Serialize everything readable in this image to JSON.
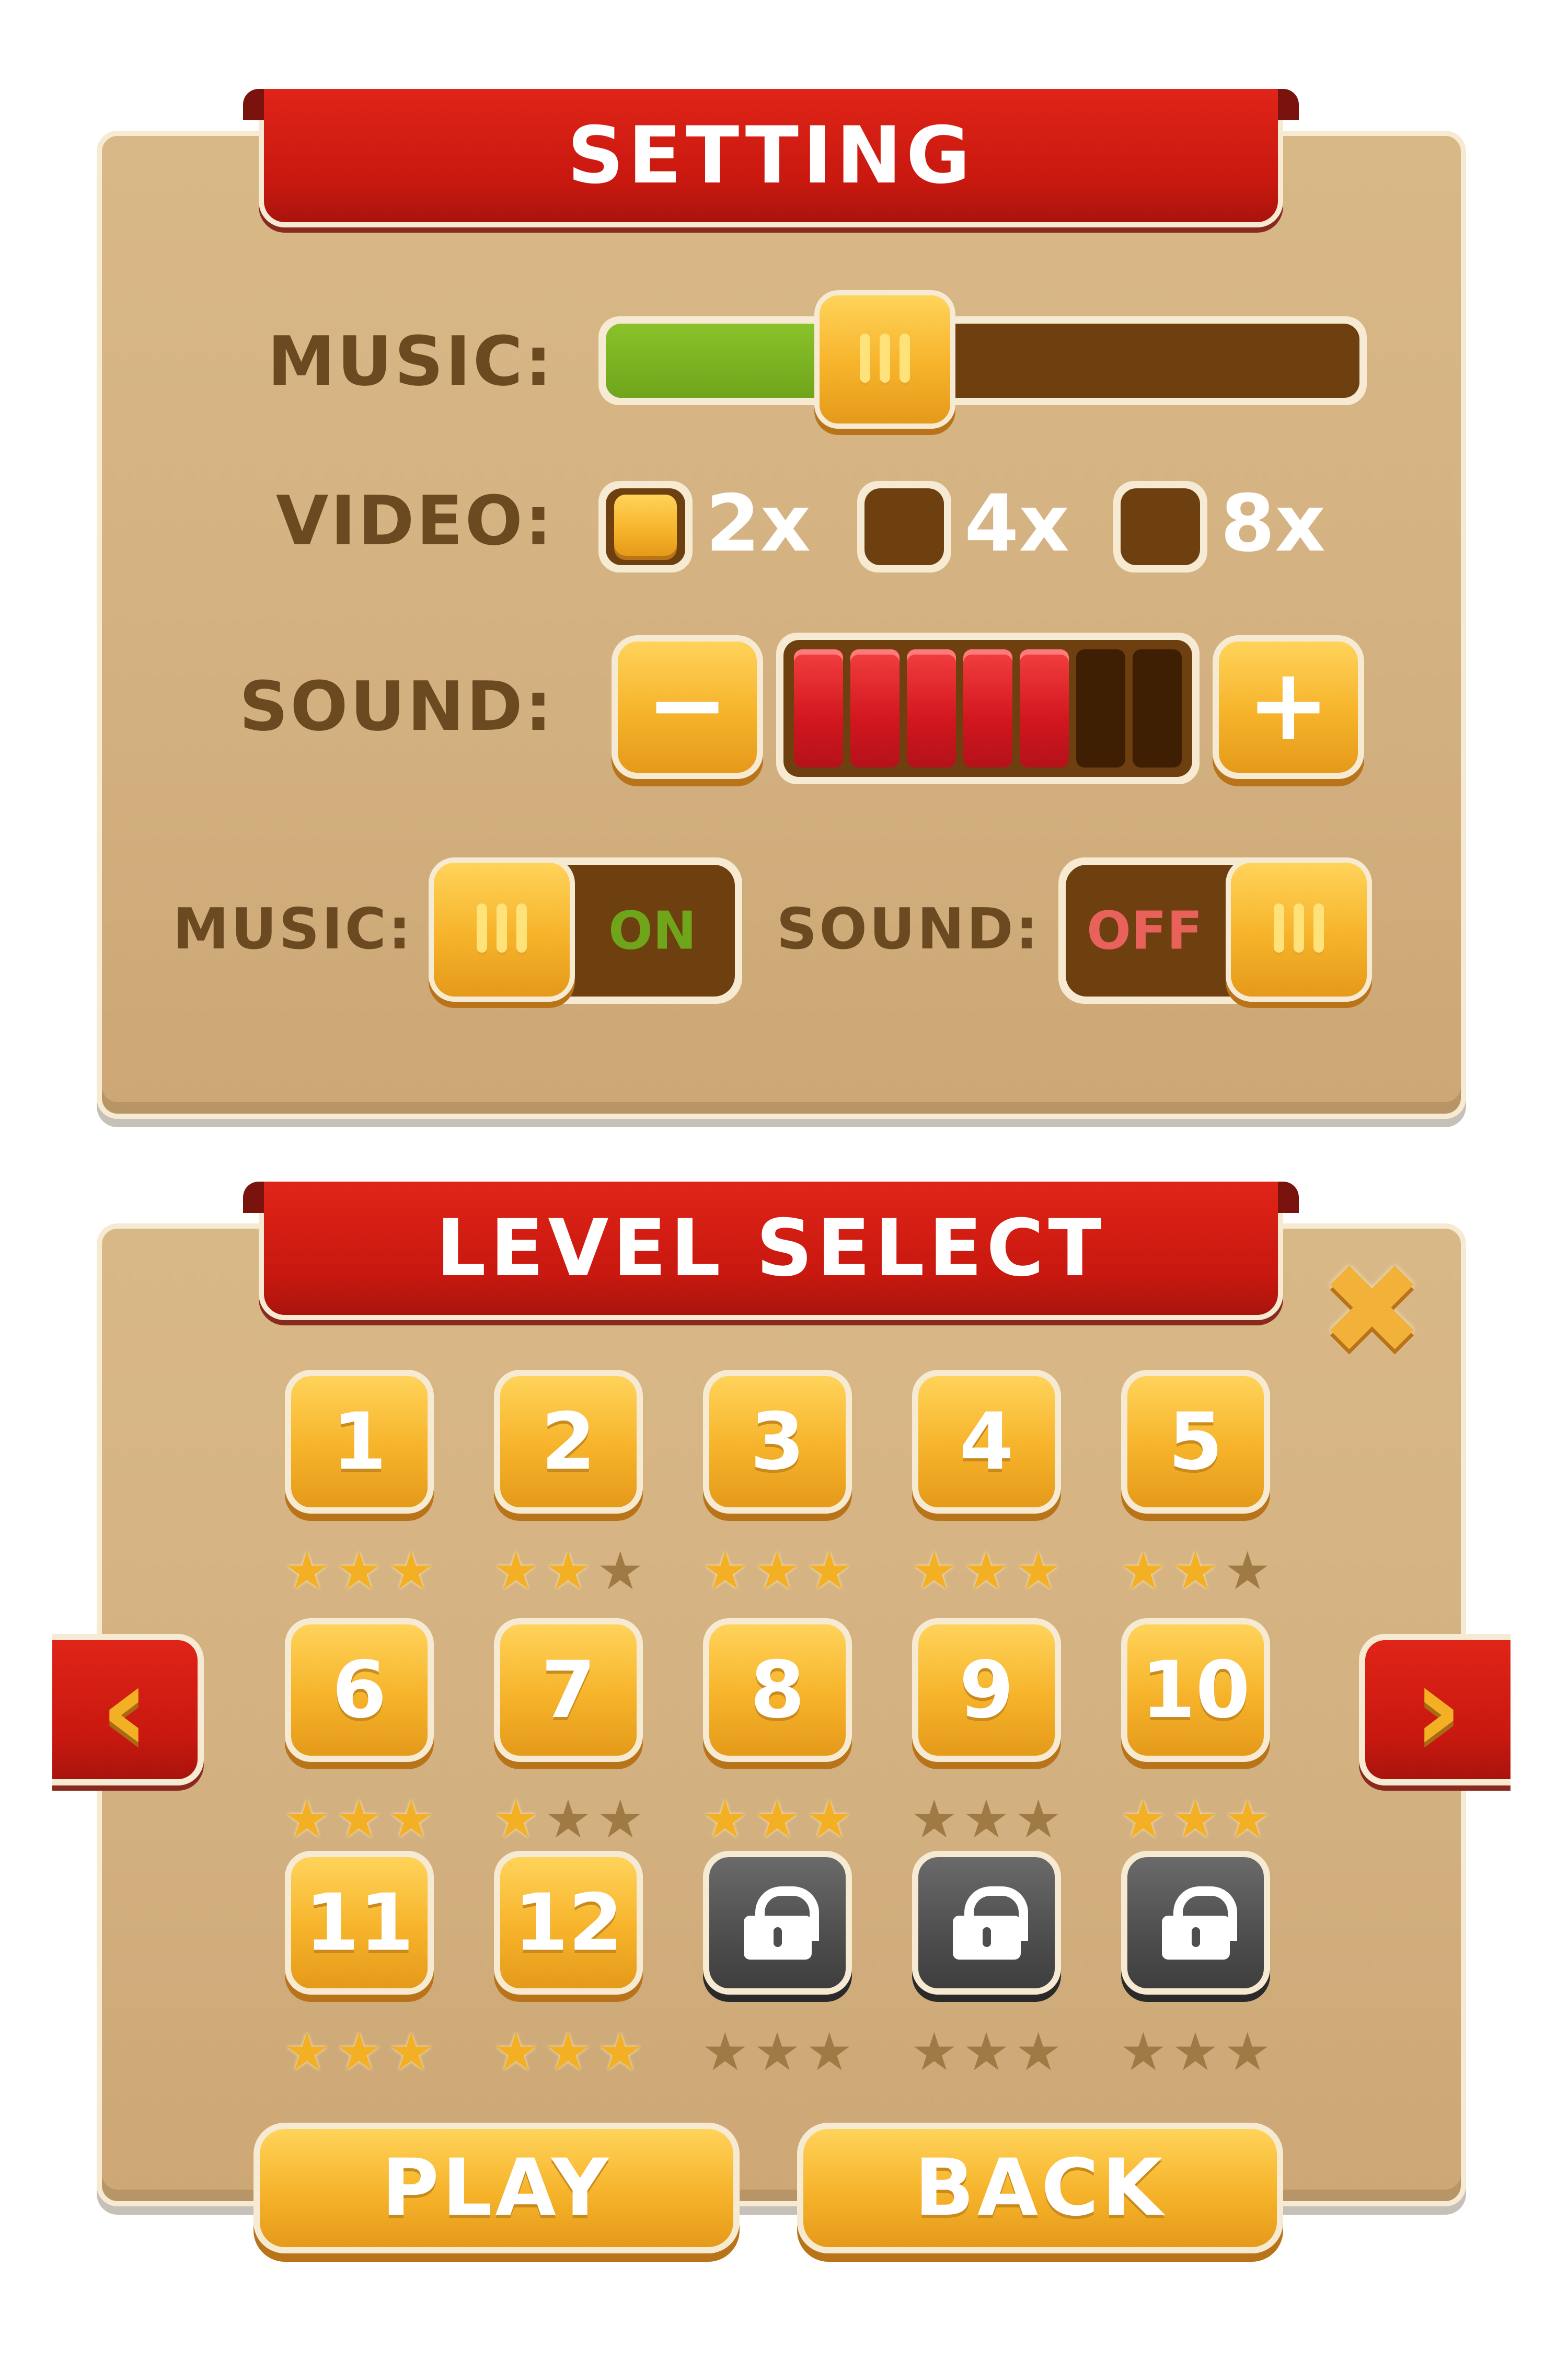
{
  "setting": {
    "title": "SETTING",
    "music_label": "MUSIC:",
    "music_level": 0.37,
    "video_label": "VIDEO:",
    "video_options": [
      {
        "label": "2x",
        "selected": true
      },
      {
        "label": "4x",
        "selected": false
      },
      {
        "label": "8x",
        "selected": false
      }
    ],
    "sound_label": "SOUND:",
    "sound_minus": "−",
    "sound_plus": "+",
    "sound_level": 5,
    "sound_max": 7,
    "music_toggle_label": "MUSIC:",
    "music_toggle_state": "ON",
    "sound_toggle_label": "SOUND:",
    "sound_toggle_state": "OFF",
    "colors": {
      "on_text": "#6fa51b",
      "off_text": "#e8615a"
    }
  },
  "level_select": {
    "title": "LEVEL SELECT",
    "close_icon": "close-icon",
    "levels": [
      {
        "label": "1",
        "locked": false,
        "stars": 3
      },
      {
        "label": "2",
        "locked": false,
        "stars": 2
      },
      {
        "label": "3",
        "locked": false,
        "stars": 3
      },
      {
        "label": "4",
        "locked": false,
        "stars": 3
      },
      {
        "label": "5",
        "locked": false,
        "stars": 2
      },
      {
        "label": "6",
        "locked": false,
        "stars": 3
      },
      {
        "label": "7",
        "locked": false,
        "stars": 1
      },
      {
        "label": "8",
        "locked": false,
        "stars": 3
      },
      {
        "label": "9",
        "locked": false,
        "stars": 0
      },
      {
        "label": "10",
        "locked": false,
        "stars": 3
      },
      {
        "label": "11",
        "locked": false,
        "stars": 3
      },
      {
        "label": "12",
        "locked": false,
        "stars": 3
      },
      {
        "label": "",
        "locked": true,
        "stars": 0
      },
      {
        "label": "",
        "locked": true,
        "stars": 0
      },
      {
        "label": "",
        "locked": true,
        "stars": 0
      }
    ],
    "prev_icon": "chevron-left-icon",
    "next_icon": "chevron-right-icon",
    "play_label": "PLAY",
    "back_label": "BACK"
  }
}
